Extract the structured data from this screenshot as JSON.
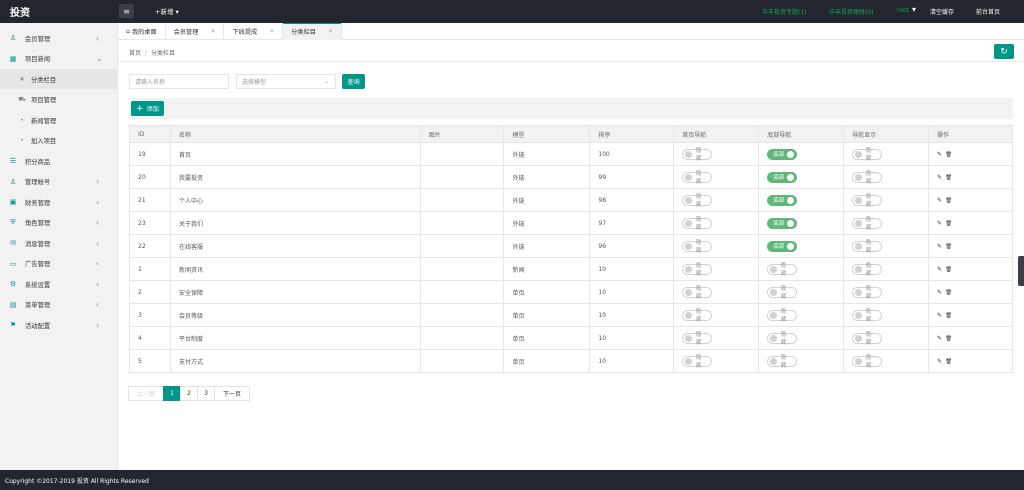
{
  "app": {
    "logo": "投资"
  },
  "topbar": {
    "new_label": "+新增",
    "links": [
      {
        "label": "华丰投资专题(1)",
        "style": "green"
      },
      {
        "label": "华丰投资理财(0)",
        "style": "green"
      },
      {
        "label": "root",
        "style": "green"
      },
      {
        "label": "清空缓存",
        "style": "white"
      },
      {
        "label": "前台首页",
        "style": "white"
      }
    ]
  },
  "sidebar": {
    "items": [
      {
        "label": "会员管理",
        "icon": "user-icon",
        "chevron": "‹",
        "sub": false
      },
      {
        "label": "项目新闻",
        "icon": "grid-icon",
        "chevron": "⌄",
        "sub": false
      },
      {
        "label": "分类栏目",
        "icon": "leaf-icon",
        "chevron": "",
        "sub": true,
        "active": true
      },
      {
        "label": "项目管理",
        "icon": "cart-icon",
        "chevron": "",
        "sub": true
      },
      {
        "label": "新闻管理",
        "icon": "dot-icon",
        "chevron": "",
        "sub": true
      },
      {
        "label": "加入项目",
        "icon": "dot-icon",
        "chevron": "",
        "sub": true
      },
      {
        "label": "积分商品",
        "icon": "list-icon",
        "chevron": "",
        "sub": false
      },
      {
        "label": "管理帐号",
        "icon": "person-icon",
        "chevron": "‹",
        "sub": false
      },
      {
        "label": "财务管理",
        "icon": "wallet-icon",
        "chevron": "‹",
        "sub": false
      },
      {
        "label": "角色管理",
        "icon": "shield-icon",
        "chevron": "‹",
        "sub": false
      },
      {
        "label": "消息管理",
        "icon": "message-icon",
        "chevron": "‹",
        "sub": false
      },
      {
        "label": "广告管理",
        "icon": "ad-icon",
        "chevron": "‹",
        "sub": false
      },
      {
        "label": "系统设置",
        "icon": "gear-icon",
        "chevron": "‹",
        "sub": false
      },
      {
        "label": "菜单管理",
        "icon": "menu-icon",
        "chevron": "‹",
        "sub": false
      },
      {
        "label": "活动配置",
        "icon": "config-icon",
        "chevron": "‹",
        "sub": false
      }
    ]
  },
  "tabs": [
    {
      "label": "我的桌面",
      "closable": false
    },
    {
      "label": "会员管理",
      "closable": true
    },
    {
      "label": "下线提成",
      "closable": true
    },
    {
      "label": "分类栏目",
      "closable": true,
      "active": true
    }
  ],
  "breadcrumb": {
    "home": "首页",
    "sep": "/",
    "current": "分类栏目"
  },
  "filters": {
    "name_placeholder": "请输入名称",
    "model_placeholder": "选择模型",
    "search_label": "查询"
  },
  "toolbar": {
    "add_label": "添加"
  },
  "table": {
    "headers": [
      "ID",
      "名称",
      "图片",
      "模型",
      "排序",
      "首页导航",
      "底部导航",
      "导航显示",
      "操作"
    ],
    "rows": [
      {
        "id": "19",
        "name": "首页",
        "model": "外链",
        "sort": "100",
        "home": "隐藏",
        "bottom": "底部",
        "bottom_on": true,
        "show": "隐藏"
      },
      {
        "id": "20",
        "name": "我要投资",
        "model": "外链",
        "sort": "99",
        "home": "隐藏",
        "bottom": "底部",
        "bottom_on": true,
        "show": "隐藏"
      },
      {
        "id": "21",
        "name": "个人中心",
        "model": "外链",
        "sort": "98",
        "home": "隐藏",
        "bottom": "底部",
        "bottom_on": true,
        "show": "隐藏"
      },
      {
        "id": "23",
        "name": "关于我们",
        "model": "外链",
        "sort": "97",
        "home": "隐藏",
        "bottom": "底部",
        "bottom_on": true,
        "show": "隐藏"
      },
      {
        "id": "22",
        "name": "在线客服",
        "model": "外链",
        "sort": "96",
        "home": "隐藏",
        "bottom": "底部",
        "bottom_on": true,
        "show": "隐藏"
      },
      {
        "id": "1",
        "name": "新闻资讯",
        "model": "新闻",
        "sort": "10",
        "home": "隐藏",
        "bottom": "隐藏",
        "bottom_on": false,
        "show": "隐藏"
      },
      {
        "id": "2",
        "name": "安全保障",
        "model": "单页",
        "sort": "10",
        "home": "隐藏",
        "bottom": "隐藏",
        "bottom_on": false,
        "show": "隐藏"
      },
      {
        "id": "3",
        "name": "会员等级",
        "model": "单页",
        "sort": "10",
        "home": "隐藏",
        "bottom": "隐藏",
        "bottom_on": false,
        "show": "隐藏"
      },
      {
        "id": "4",
        "name": "平台制度",
        "model": "单页",
        "sort": "10",
        "home": "隐藏",
        "bottom": "隐藏",
        "bottom_on": false,
        "show": "隐藏"
      },
      {
        "id": "5",
        "name": "支付方式",
        "model": "单页",
        "sort": "10",
        "home": "隐藏",
        "bottom": "隐藏",
        "bottom_on": false,
        "show": "隐藏"
      }
    ]
  },
  "pager": {
    "prev": "上一页",
    "pages": [
      "1",
      "2",
      "3"
    ],
    "current": "1",
    "next": "下一页"
  },
  "footer": {
    "copyright": "Copyright ©2017-2019 投资 All Rights Reserved"
  },
  "colors": {
    "accent": "#009688",
    "switch_on": "#5fb878",
    "topbar": "#23262e",
    "link_green": "#17a35b"
  }
}
